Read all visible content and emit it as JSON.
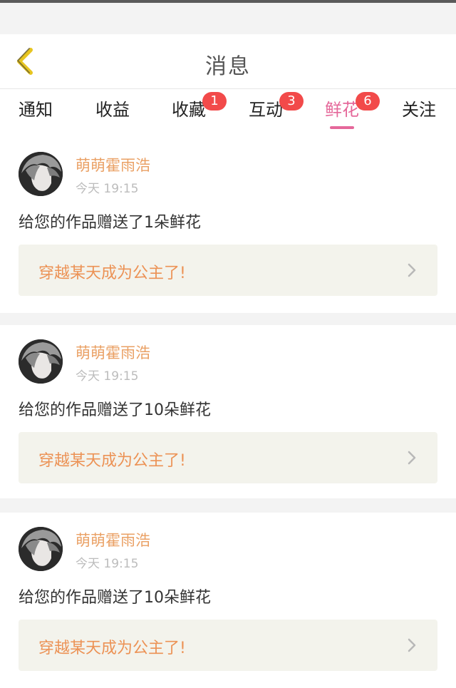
{
  "header": {
    "title": "消息",
    "back_icon": "chevron-left-icon",
    "back_icon_color": "#e7c520"
  },
  "tabs": [
    {
      "label": "通知",
      "badge": ""
    },
    {
      "label": "收益",
      "badge": ""
    },
    {
      "label": "收藏",
      "badge": "1"
    },
    {
      "label": "互动",
      "badge": "3"
    },
    {
      "label": "鲜花",
      "badge": "6",
      "active": true
    },
    {
      "label": "关注",
      "badge": ""
    }
  ],
  "colors": {
    "accent": "#e5689a",
    "badge": "#f24a4a",
    "username": "#eaa064",
    "work_link_text": "#ec9255"
  },
  "messages": [
    {
      "username": "萌萌霍雨浩",
      "time": "今天 19:15",
      "text": "给您的作品赠送了1朵鲜花",
      "work_title": "穿越某天成为公主了!"
    },
    {
      "username": "萌萌霍雨浩",
      "time": "今天 19:15",
      "text": "给您的作品赠送了10朵鲜花",
      "work_title": "穿越某天成为公主了!"
    },
    {
      "username": "萌萌霍雨浩",
      "time": "今天 19:15",
      "text": "给您的作品赠送了10朵鲜花",
      "work_title": "穿越某天成为公主了!"
    }
  ]
}
